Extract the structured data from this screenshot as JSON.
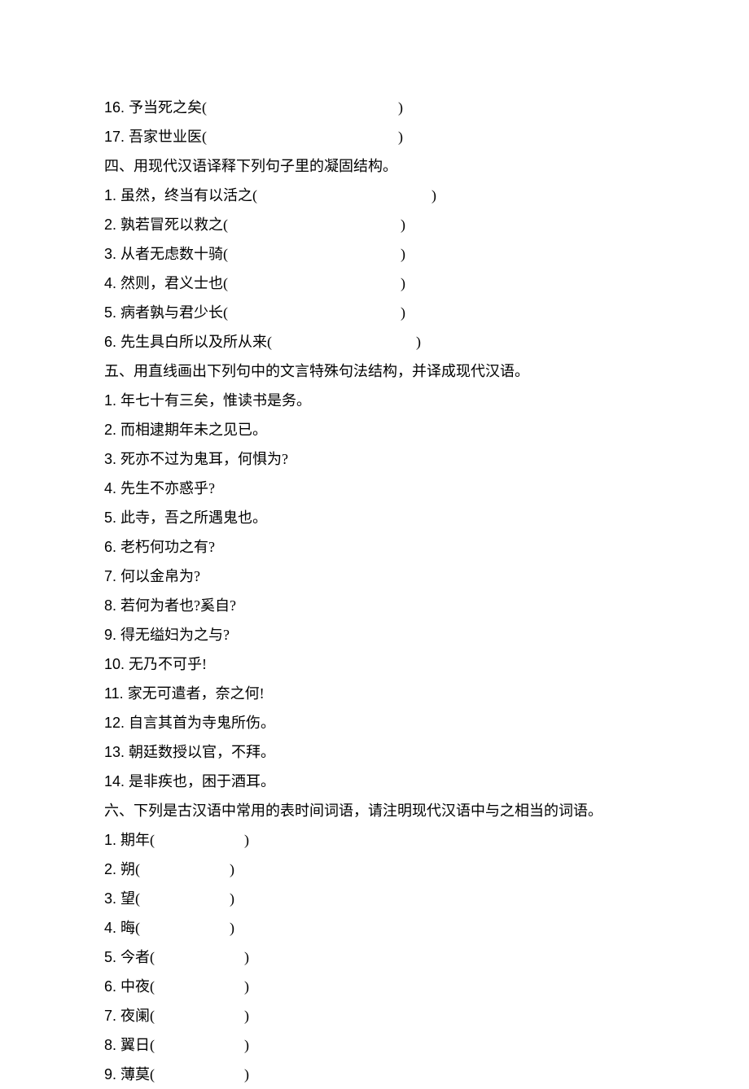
{
  "q16": {
    "num": "16. ",
    "text": "予当死之矣(",
    "paren": ")"
  },
  "q17": {
    "num": "17. ",
    "text": "吾家世业医(",
    "paren": ")"
  },
  "section4": "四、用现代汉语译释下列句子里的凝固结构。",
  "s4q1": {
    "num": "1. ",
    "text": "虽然，终当有以活之(",
    "paren": ")"
  },
  "s4q2": {
    "num": "2. ",
    "text": "孰若冒死以救之(",
    "paren": ")"
  },
  "s4q3": {
    "num": "3. ",
    "text": "从者无虑数十骑(",
    "paren": ")"
  },
  "s4q4": {
    "num": "4. ",
    "text": "然则，君义士也(",
    "paren": ")"
  },
  "s4q5": {
    "num": "5. ",
    "text": "病者孰与君少长(",
    "paren": ")"
  },
  "s4q6": {
    "num": "6. ",
    "text": "先生具白所以及所从来(",
    "paren": ")"
  },
  "section5": "五、用直线画出下列句中的文言特殊句法结构，并译成现代汉语。",
  "s5q1": {
    "num": "1. ",
    "text": "年七十有三矣，惟读书是务。"
  },
  "s5q2": {
    "num": "2. ",
    "text": "而相逮期年未之见已。"
  },
  "s5q3": {
    "num": "3. ",
    "text": "死亦不过为鬼耳，何惧为?"
  },
  "s5q4": {
    "num": "4. ",
    "text": "先生不亦惑乎?"
  },
  "s5q5": {
    "num": "5. ",
    "text": "此寺，吾之所遇鬼也。"
  },
  "s5q6": {
    "num": "6. ",
    "text": "老朽何功之有?"
  },
  "s5q7": {
    "num": "7. ",
    "text": "何以金帛为?"
  },
  "s5q8": {
    "num": "8. ",
    "text": "若何为者也?奚自?"
  },
  "s5q9": {
    "num": "9. ",
    "text": "得无缢妇为之与?"
  },
  "s5q10": {
    "num": "10. ",
    "text": "无乃不可乎!"
  },
  "s5q11": {
    "num": "11. ",
    "text": "家无可遣者，奈之何!"
  },
  "s5q12": {
    "num": "12. ",
    "text": "自言其首为寺鬼所伤。"
  },
  "s5q13": {
    "num": "13. ",
    "text": "朝廷数授以官，不拜。"
  },
  "s5q14": {
    "num": "14. ",
    "text": "是非疾也，困于酒耳。"
  },
  "section6": "六、下列是古汉语中常用的表时间词语，请注明现代汉语中与之相当的词语。",
  "s6q1": {
    "num": "1. ",
    "text": "期年(",
    "paren": ")"
  },
  "s6q2": {
    "num": "2. ",
    "text": "朔(",
    "paren": ")"
  },
  "s6q3": {
    "num": "3. ",
    "text": "望(",
    "paren": ")"
  },
  "s6q4": {
    "num": "4. ",
    "text": "晦(",
    "paren": ")"
  },
  "s6q5": {
    "num": "5. ",
    "text": "今者(",
    "paren": ")"
  },
  "s6q6": {
    "num": "6. ",
    "text": "中夜(",
    "paren": ")"
  },
  "s6q7": {
    "num": "7. ",
    "text": "夜阑(",
    "paren": ")"
  },
  "s6q8": {
    "num": "8. ",
    "text": "翼日(",
    "paren": ")"
  },
  "s6q9": {
    "num": "9. ",
    "text": "薄莫(",
    "paren": ")"
  }
}
